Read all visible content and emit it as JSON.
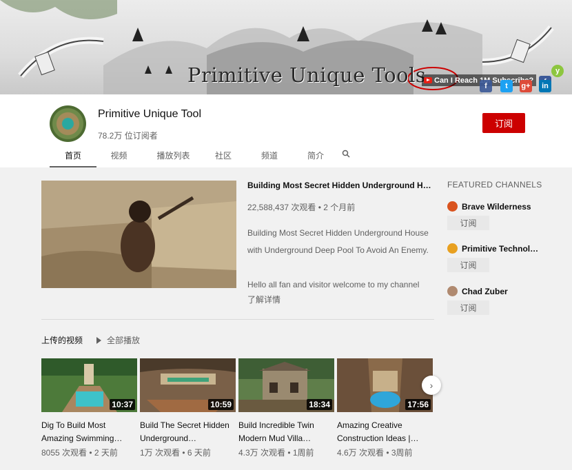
{
  "banner": {
    "title": "Primitive Unique Tools",
    "link_text": "Can I Reach 1M Subscribe?",
    "social": [
      "f",
      "t",
      "g+",
      "in"
    ],
    "social_colors": [
      "#3b5998",
      "#1da1f2",
      "#dd4b39",
      "#0077b5"
    ]
  },
  "channel": {
    "name": "Primitive Unique Tool",
    "subscribers": "78.2万 位订阅者",
    "subscribe_label": "订阅"
  },
  "tabs": [
    "首页",
    "视频",
    "播放列表",
    "社区",
    "频道",
    "简介"
  ],
  "featured": {
    "title": "Building Most Secret Hidden Underground Hous…",
    "meta": "22,588,437 次观看 • 2 个月前",
    "description": "Building Most Secret Hidden Underground House with Underground Deep Pool To Avoid An Enemy.",
    "greeting": "Hello all fan and visitor welcome to my channel",
    "more": "了解详情"
  },
  "shelf": {
    "title": "上传的视频",
    "play_all": "全部播放",
    "videos": [
      {
        "title": "Dig To Build Most Amazing Swimming…",
        "duration": "10:37",
        "meta": "8055 次观看 • 2 天前"
      },
      {
        "title": "Build The Secret Hidden Underground…",
        "duration": "10:59",
        "meta": "1万 次观看 • 6 天前"
      },
      {
        "title": "Build Incredible Twin Modern Mud Villa…",
        "duration": "18:34",
        "meta": "4.3万 次观看 • 1周前"
      },
      {
        "title": "Amazing Creative Construction Ideas |…",
        "duration": "17:56",
        "meta": "4.6万 次观看 • 3周前"
      }
    ]
  },
  "sidebar": {
    "heading": "FEATURED CHANNELS",
    "channels": [
      {
        "name": "Brave Wilderness",
        "subscribe": "订阅",
        "color": "#d9531e"
      },
      {
        "name": "Primitive Technol…",
        "subscribe": "订阅",
        "color": "#e8a020"
      },
      {
        "name": "Chad Zuber",
        "subscribe": "订阅",
        "color": "#b08a70"
      }
    ]
  }
}
